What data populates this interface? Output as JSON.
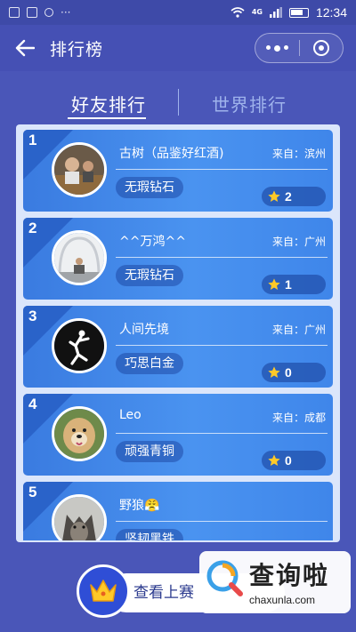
{
  "status_bar": {
    "time": "12:34",
    "network": "4G"
  },
  "header": {
    "title": "排行榜"
  },
  "tabs": [
    {
      "label": "好友排行",
      "active": true
    },
    {
      "label": "世界排行",
      "active": false
    }
  ],
  "ranking": [
    {
      "rank": "1",
      "name": "古树（品鉴好红酒)",
      "origin": "来自：滨州",
      "level": "无瑕钻石",
      "stars": "2"
    },
    {
      "rank": "2",
      "name": "^^万鸿^^",
      "origin": "来自：广州",
      "level": "无瑕钻石",
      "stars": "1"
    },
    {
      "rank": "3",
      "name": "人间先境",
      "origin": "来自：广州",
      "level": "巧思白金",
      "stars": "0"
    },
    {
      "rank": "4",
      "name": "Leo",
      "origin": "来自：成都",
      "level": "顽强青铜",
      "stars": "0"
    },
    {
      "rank": "5",
      "name": "野狼😤",
      "origin": "",
      "level": "坚韧黑铁",
      "stars": ""
    }
  ],
  "bottom": {
    "view_button_label": "查看上赛"
  },
  "watermark": {
    "text": "查询啦",
    "url": "chaxunla.com"
  },
  "colors": {
    "background": "#4a56b8",
    "card": "#4a93f0",
    "panel": "#dbe6fb"
  }
}
